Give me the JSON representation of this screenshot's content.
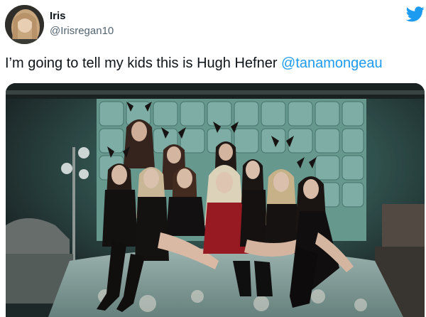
{
  "user": {
    "display_name": "Iris",
    "handle": "@Irisregan10",
    "avatar_icon": "profile-avatar"
  },
  "tweet": {
    "text": "I’m going to tell my kids this is Hugh Hefner ",
    "mention": "@tanamongeau"
  },
  "brand": {
    "icon": "twitter-bird-icon",
    "color": "#1d9bf0"
  },
  "media": {
    "type": "photo"
  }
}
